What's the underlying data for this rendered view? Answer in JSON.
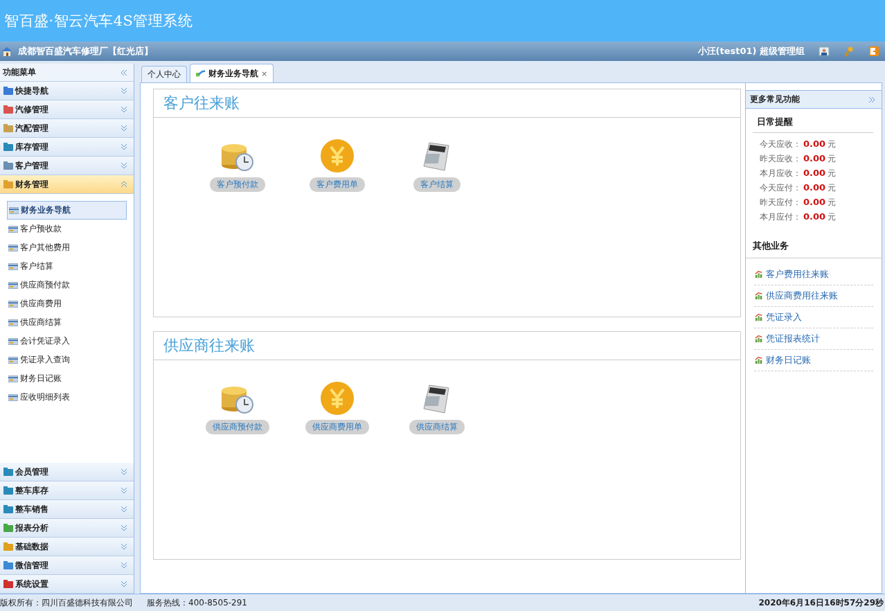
{
  "app_title": "智百盛·智云汽车4S管理系统",
  "info_bar": {
    "store": "成都智百盛汽车修理厂【红光店】",
    "user": "小汪(test01) 超级管理组"
  },
  "sidebar": {
    "title": "功能菜单",
    "groups": [
      {
        "label": "快捷导航",
        "expanded": false
      },
      {
        "label": "汽修管理",
        "expanded": false
      },
      {
        "label": "汽配管理",
        "expanded": false
      },
      {
        "label": "库存管理",
        "expanded": false
      },
      {
        "label": "客户管理",
        "expanded": false
      },
      {
        "label": "财务管理",
        "expanded": true,
        "children": [
          {
            "label": "财务业务导航",
            "selected": true
          },
          {
            "label": "客户预收款",
            "selected": false
          },
          {
            "label": "客户其他费用",
            "selected": false
          },
          {
            "label": "客户结算",
            "selected": false
          },
          {
            "label": "供应商预付款",
            "selected": false
          },
          {
            "label": "供应商费用",
            "selected": false
          },
          {
            "label": "供应商结算",
            "selected": false
          },
          {
            "label": "会计凭证录入",
            "selected": false
          },
          {
            "label": "凭证录入查询",
            "selected": false
          },
          {
            "label": "财务日记账",
            "selected": false
          },
          {
            "label": "应收明细列表",
            "selected": false
          }
        ]
      },
      {
        "label": "会员管理",
        "expanded": false
      },
      {
        "label": "整车库存",
        "expanded": false
      },
      {
        "label": "整车销售",
        "expanded": false
      },
      {
        "label": "报表分析",
        "expanded": false
      },
      {
        "label": "基础数据",
        "expanded": false
      },
      {
        "label": "微信管理",
        "expanded": false
      },
      {
        "label": "系统设置",
        "expanded": false
      }
    ]
  },
  "tabs": [
    {
      "label": "个人中心",
      "selected": false
    },
    {
      "label": "财务业务导航",
      "selected": true,
      "close": "×"
    }
  ],
  "sections": [
    {
      "title": "客户往来账",
      "items": [
        {
          "kind": "coins",
          "label": "客户预付款"
        },
        {
          "kind": "yuan",
          "label": "客户费用单"
        },
        {
          "kind": "calculator",
          "label": "客户结算"
        }
      ]
    },
    {
      "title": "供应商往来账",
      "items": [
        {
          "kind": "coins",
          "label": "供应商预付款"
        },
        {
          "kind": "yuan",
          "label": "供应商费用单"
        },
        {
          "kind": "calculator",
          "label": "供应商结算"
        }
      ]
    }
  ],
  "right_panel": {
    "title": "更多常见功能",
    "reminder_title": "日常提醒",
    "reminders": [
      {
        "label": "今天应收：",
        "value": "0.00",
        "unit": "元"
      },
      {
        "label": "昨天应收：",
        "value": "0.00",
        "unit": "元"
      },
      {
        "label": "本月应收：",
        "value": "0.00",
        "unit": "元"
      },
      {
        "label": "今天应付：",
        "value": "0.00",
        "unit": "元"
      },
      {
        "label": "昨天应付：",
        "value": "0.00",
        "unit": "元"
      },
      {
        "label": "本月应付：",
        "value": "0.00",
        "unit": "元"
      }
    ],
    "other_title": "其他业务",
    "links": [
      "客户费用往来账",
      "供应商费用往来账",
      "凭证录入",
      "凭证报表统计",
      "财务日记账"
    ]
  },
  "status_bar": {
    "copyright": "版权所有：四川百盛德科技有限公司",
    "hotline": "服务热线：400-8505-291",
    "datetime": "2020年6月16日16时57分29秒"
  }
}
